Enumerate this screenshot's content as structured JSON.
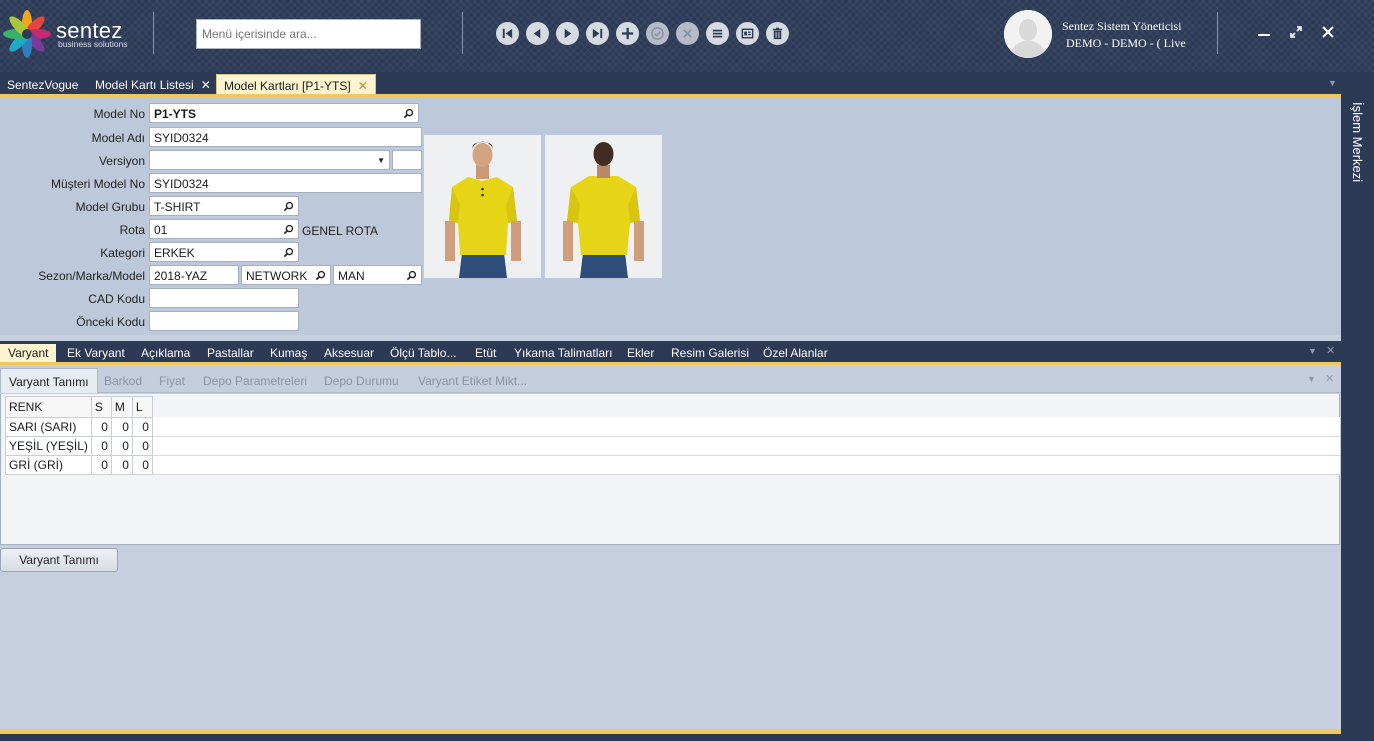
{
  "app": {
    "brand": "sentez",
    "tagline": "business solutions",
    "search_placeholder": "Menü içerisinde ara...",
    "user_name": "Sentez Sistem Yöneticisi",
    "user_company": "DEMO - DEMO - ( Live"
  },
  "toolbar": {
    "icons": [
      "first-record-icon",
      "previous-record-icon",
      "next-record-icon",
      "last-record-icon",
      "add-icon",
      "confirm-icon",
      "cancel-icon",
      "list-icon",
      "form-icon",
      "delete-icon"
    ]
  },
  "doc_tabs": [
    {
      "label": "SentezVogue"
    },
    {
      "label": "Model Kartı Listesi"
    },
    {
      "label": "Model Kartları [P1-YTS]"
    }
  ],
  "side_panel": {
    "label": "İşlem Merkezi"
  },
  "form": {
    "model_no": {
      "label": "Model No",
      "value": "P1-YTS"
    },
    "model_adi": {
      "label": "Model Adı",
      "value": "SYID0324"
    },
    "versiyon": {
      "label": "Versiyon",
      "value": "",
      "value2": ""
    },
    "musteri_model_no": {
      "label": "Müşteri Model No",
      "value": "SYID0324"
    },
    "model_grubu": {
      "label": "Model Grubu",
      "value": "T-SHIRT"
    },
    "rota": {
      "label": "Rota",
      "value": "01",
      "description": "GENEL ROTA"
    },
    "kategori": {
      "label": "Kategori",
      "value": "ERKEK"
    },
    "sezon_marka_model": {
      "label": "Sezon/Marka/Model",
      "sezon": "2018-YAZ",
      "marka": "NETWORK",
      "model": "MAN"
    },
    "cad_kodu": {
      "label": "CAD Kodu",
      "value": ""
    },
    "onceki_kodu": {
      "label": "Önceki Kodu",
      "value": ""
    }
  },
  "section_tabs": [
    {
      "label": "Varyant"
    },
    {
      "label": "Ek Varyant"
    },
    {
      "label": "Açıklama"
    },
    {
      "label": "Pastallar"
    },
    {
      "label": "Kumaş"
    },
    {
      "label": "Aksesuar"
    },
    {
      "label": "Ölçü Tablo..."
    },
    {
      "label": "Etüt"
    },
    {
      "label": "Yıkama Talimatları"
    },
    {
      "label": "Ekler"
    },
    {
      "label": "Resim Galerisi"
    },
    {
      "label": "Özel Alanlar"
    }
  ],
  "sub_tabs": [
    {
      "label": "Varyant Tanımı"
    },
    {
      "label": "Barkod"
    },
    {
      "label": "Fiyat"
    },
    {
      "label": "Depo Parametreleri"
    },
    {
      "label": "Depo Durumu"
    },
    {
      "label": "Varyant Etiket Mikt..."
    }
  ],
  "grid": {
    "columns": [
      "RENK",
      "S",
      "M",
      "L"
    ],
    "rows": [
      [
        "SARI (SARI)",
        "0",
        "0",
        "0"
      ],
      [
        "YEŞİL (YEŞİL)",
        "0",
        "0",
        "0"
      ],
      [
        "GRİ (GRİ)",
        "0",
        "0",
        "0"
      ]
    ]
  },
  "bottom_button": {
    "label": "Varyant Tanımı"
  },
  "colors": {
    "accent": "#f1c95a",
    "header_bg": "#2c3a56",
    "form_bg": "#bdc8da",
    "shirt": "#e6d516"
  }
}
